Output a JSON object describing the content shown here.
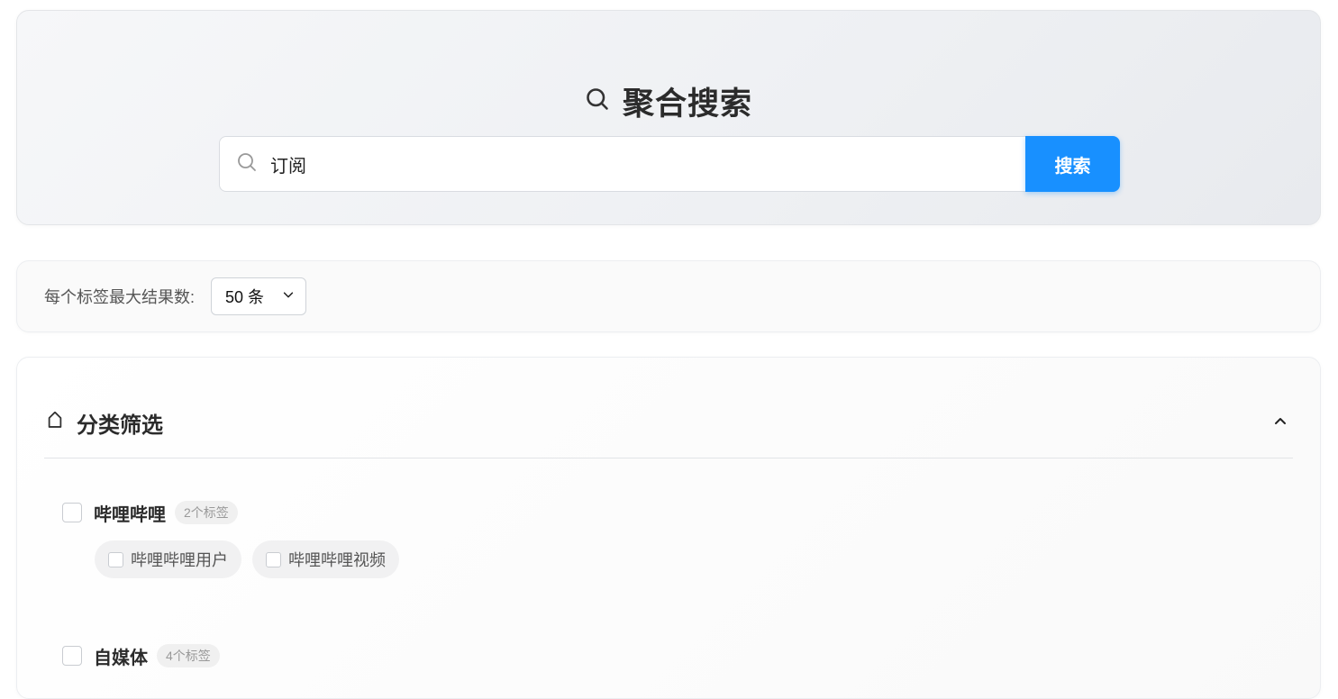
{
  "hero": {
    "title": "聚合搜索",
    "title_icon": "search-icon",
    "search_value": "订阅",
    "search_icon": "search-icon",
    "search_button": "搜索",
    "accent": "#1890ff"
  },
  "limit": {
    "label": "每个标签最大结果数:",
    "selected": "50 条",
    "icon": "chevron-down-icon"
  },
  "filter": {
    "title": "分类筛选",
    "icon": "tag-icon",
    "collapse_icon": "chevron-up-icon",
    "groups": [
      {
        "name": "哔哩哔哩",
        "count": "2个标签",
        "tags": [
          "哔哩哔哩用户",
          "哔哩哔哩视频"
        ]
      },
      {
        "name": "自媒体",
        "count": "4个标签",
        "tags": []
      }
    ]
  }
}
